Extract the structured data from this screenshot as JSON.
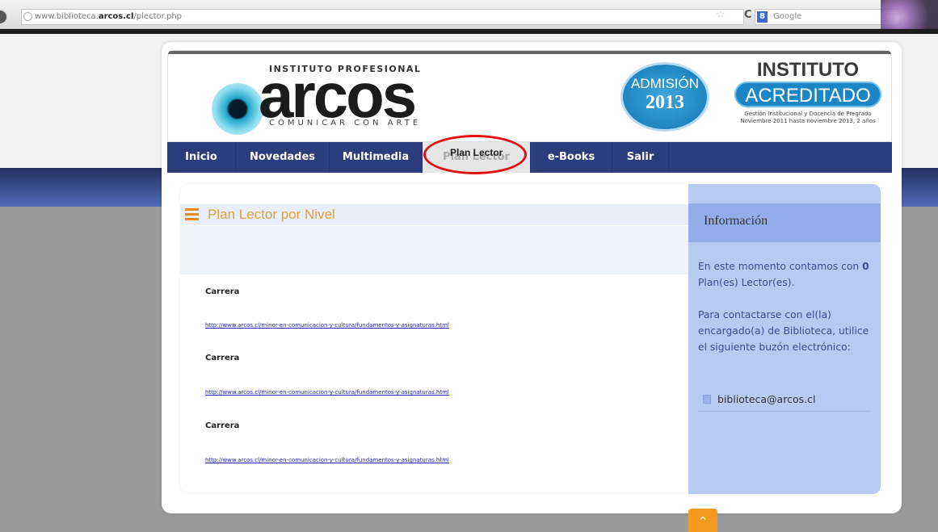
{
  "browser": {
    "url_prefix": "www.biblioteca.",
    "url_domain": "arcos.cl",
    "url_path": "/plector.php",
    "search_engine": "Google",
    "search_badge": "8"
  },
  "header": {
    "logo_top": "INSTITUTO PROFESIONAL",
    "logo_main": "arcos",
    "logo_tagline": "COMUNICAR CON ARTE",
    "admision_label": "ADMISIÓN",
    "admision_year": "2013",
    "acreditado_top": "INSTITUTO",
    "acreditado_main": "ACREDITADO",
    "acreditado_line1": "Gestión Institucional y Docencia de Pregrado",
    "acreditado_line2": "Noviembre 2011 hasta noviembre 2013, 2 años"
  },
  "nav": {
    "items": [
      {
        "label": "Inicio"
      },
      {
        "label": "Novedades"
      },
      {
        "label": "Multimedia"
      },
      {
        "label": "Plan Lector"
      },
      {
        "label": "e-Books"
      },
      {
        "label": "Salir"
      }
    ],
    "highlight_label": "Plan Lector"
  },
  "main": {
    "title": "Plan Lector por Nivel",
    "entries": [
      {
        "label": "Carrera",
        "link": "http://www.arcos.cl/minor-en-comunicacion-y-cultura/fundamentos-y-asignaturas.html"
      },
      {
        "label": "Carrera",
        "link": "http://www.arcos.cl/minor-en-comunicacion-y-cultura/fundamentos-y-asignaturas.html"
      },
      {
        "label": "Carrera",
        "link": "http://www.arcos.cl/minor-en-comunicacion-y-cultura/fundamentos-y-asignaturas.html"
      }
    ]
  },
  "sidebar": {
    "title": "Información",
    "text1_prefix": "En este momento contamos con ",
    "count": "0",
    "text1_suffix": " Plan(es) Lector(es).",
    "text2": "Para contactarse con el(la) encargado(a) de Biblioteca, utilice el siguiente buzón electrónico:",
    "email": "biblioteca@arcos.cl"
  },
  "colors": {
    "nav_bg": "#2c3d7e",
    "accent_orange": "#e0a036",
    "sidebar_bg": "#b7cbf2",
    "highlight_red": "#e11010"
  }
}
